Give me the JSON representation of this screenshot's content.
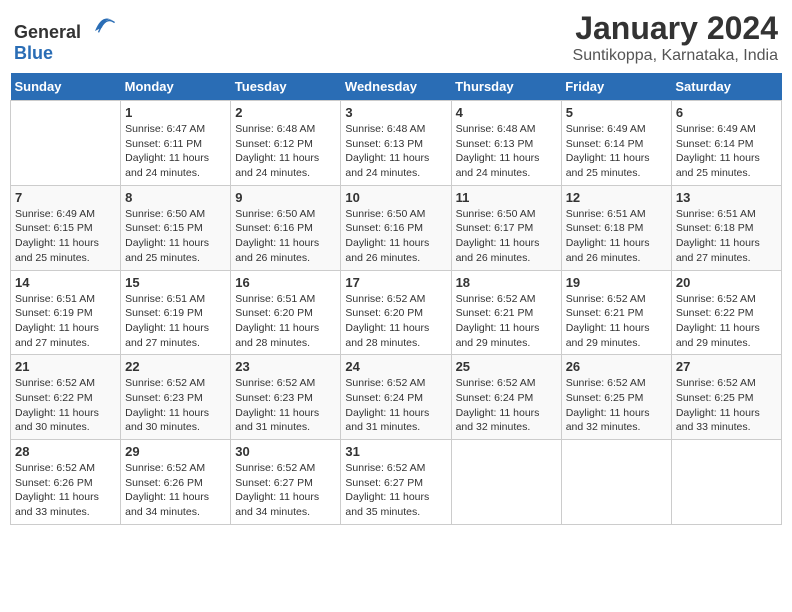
{
  "logo": {
    "text_general": "General",
    "text_blue": "Blue"
  },
  "title": "January 2024",
  "subtitle": "Suntikoppa, Karnataka, India",
  "days_of_week": [
    "Sunday",
    "Monday",
    "Tuesday",
    "Wednesday",
    "Thursday",
    "Friday",
    "Saturday"
  ],
  "weeks": [
    [
      {
        "day": "",
        "info": ""
      },
      {
        "day": "1",
        "info": "Sunrise: 6:47 AM\nSunset: 6:11 PM\nDaylight: 11 hours\nand 24 minutes."
      },
      {
        "day": "2",
        "info": "Sunrise: 6:48 AM\nSunset: 6:12 PM\nDaylight: 11 hours\nand 24 minutes."
      },
      {
        "day": "3",
        "info": "Sunrise: 6:48 AM\nSunset: 6:13 PM\nDaylight: 11 hours\nand 24 minutes."
      },
      {
        "day": "4",
        "info": "Sunrise: 6:48 AM\nSunset: 6:13 PM\nDaylight: 11 hours\nand 24 minutes."
      },
      {
        "day": "5",
        "info": "Sunrise: 6:49 AM\nSunset: 6:14 PM\nDaylight: 11 hours\nand 25 minutes."
      },
      {
        "day": "6",
        "info": "Sunrise: 6:49 AM\nSunset: 6:14 PM\nDaylight: 11 hours\nand 25 minutes."
      }
    ],
    [
      {
        "day": "7",
        "info": "Sunrise: 6:49 AM\nSunset: 6:15 PM\nDaylight: 11 hours\nand 25 minutes."
      },
      {
        "day": "8",
        "info": "Sunrise: 6:50 AM\nSunset: 6:15 PM\nDaylight: 11 hours\nand 25 minutes."
      },
      {
        "day": "9",
        "info": "Sunrise: 6:50 AM\nSunset: 6:16 PM\nDaylight: 11 hours\nand 26 minutes."
      },
      {
        "day": "10",
        "info": "Sunrise: 6:50 AM\nSunset: 6:16 PM\nDaylight: 11 hours\nand 26 minutes."
      },
      {
        "day": "11",
        "info": "Sunrise: 6:50 AM\nSunset: 6:17 PM\nDaylight: 11 hours\nand 26 minutes."
      },
      {
        "day": "12",
        "info": "Sunrise: 6:51 AM\nSunset: 6:18 PM\nDaylight: 11 hours\nand 26 minutes."
      },
      {
        "day": "13",
        "info": "Sunrise: 6:51 AM\nSunset: 6:18 PM\nDaylight: 11 hours\nand 27 minutes."
      }
    ],
    [
      {
        "day": "14",
        "info": "Sunrise: 6:51 AM\nSunset: 6:19 PM\nDaylight: 11 hours\nand 27 minutes."
      },
      {
        "day": "15",
        "info": "Sunrise: 6:51 AM\nSunset: 6:19 PM\nDaylight: 11 hours\nand 27 minutes."
      },
      {
        "day": "16",
        "info": "Sunrise: 6:51 AM\nSunset: 6:20 PM\nDaylight: 11 hours\nand 28 minutes."
      },
      {
        "day": "17",
        "info": "Sunrise: 6:52 AM\nSunset: 6:20 PM\nDaylight: 11 hours\nand 28 minutes."
      },
      {
        "day": "18",
        "info": "Sunrise: 6:52 AM\nSunset: 6:21 PM\nDaylight: 11 hours\nand 29 minutes."
      },
      {
        "day": "19",
        "info": "Sunrise: 6:52 AM\nSunset: 6:21 PM\nDaylight: 11 hours\nand 29 minutes."
      },
      {
        "day": "20",
        "info": "Sunrise: 6:52 AM\nSunset: 6:22 PM\nDaylight: 11 hours\nand 29 minutes."
      }
    ],
    [
      {
        "day": "21",
        "info": "Sunrise: 6:52 AM\nSunset: 6:22 PM\nDaylight: 11 hours\nand 30 minutes."
      },
      {
        "day": "22",
        "info": "Sunrise: 6:52 AM\nSunset: 6:23 PM\nDaylight: 11 hours\nand 30 minutes."
      },
      {
        "day": "23",
        "info": "Sunrise: 6:52 AM\nSunset: 6:23 PM\nDaylight: 11 hours\nand 31 minutes."
      },
      {
        "day": "24",
        "info": "Sunrise: 6:52 AM\nSunset: 6:24 PM\nDaylight: 11 hours\nand 31 minutes."
      },
      {
        "day": "25",
        "info": "Sunrise: 6:52 AM\nSunset: 6:24 PM\nDaylight: 11 hours\nand 32 minutes."
      },
      {
        "day": "26",
        "info": "Sunrise: 6:52 AM\nSunset: 6:25 PM\nDaylight: 11 hours\nand 32 minutes."
      },
      {
        "day": "27",
        "info": "Sunrise: 6:52 AM\nSunset: 6:25 PM\nDaylight: 11 hours\nand 33 minutes."
      }
    ],
    [
      {
        "day": "28",
        "info": "Sunrise: 6:52 AM\nSunset: 6:26 PM\nDaylight: 11 hours\nand 33 minutes."
      },
      {
        "day": "29",
        "info": "Sunrise: 6:52 AM\nSunset: 6:26 PM\nDaylight: 11 hours\nand 34 minutes."
      },
      {
        "day": "30",
        "info": "Sunrise: 6:52 AM\nSunset: 6:27 PM\nDaylight: 11 hours\nand 34 minutes."
      },
      {
        "day": "31",
        "info": "Sunrise: 6:52 AM\nSunset: 6:27 PM\nDaylight: 11 hours\nand 35 minutes."
      },
      {
        "day": "",
        "info": ""
      },
      {
        "day": "",
        "info": ""
      },
      {
        "day": "",
        "info": ""
      }
    ]
  ]
}
